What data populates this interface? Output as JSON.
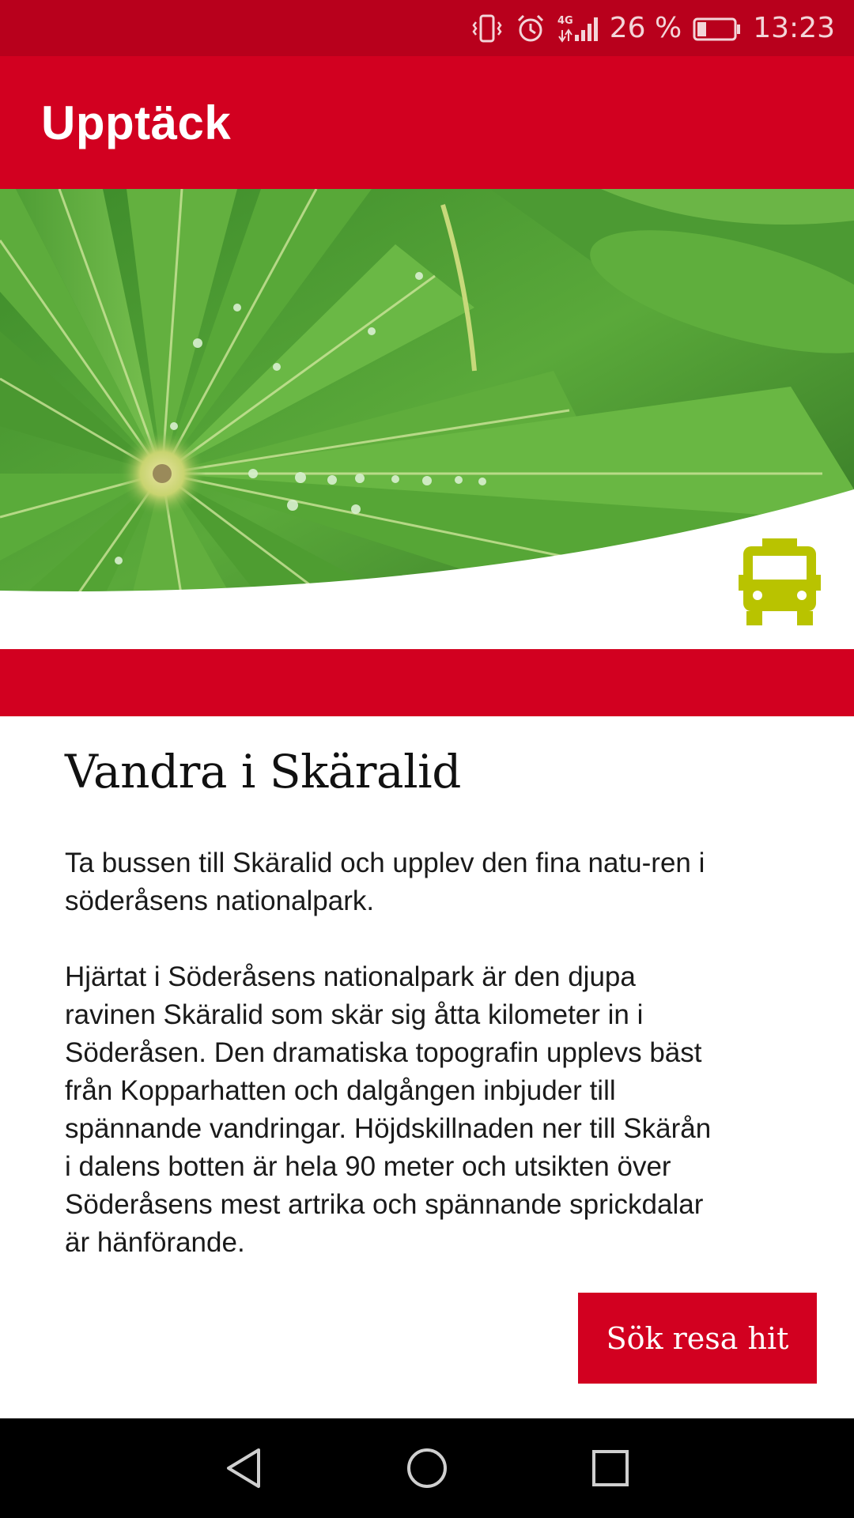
{
  "status_bar": {
    "network": "4G",
    "battery_percent": "26 %",
    "battery_level": 0.26,
    "time": "13:23",
    "icons": [
      "vibrate-icon",
      "alarm-icon",
      "signal-icon",
      "battery-icon"
    ]
  },
  "app_bar": {
    "title": "Upptäck"
  },
  "hero": {
    "image": "lupine-leaves-with-water-drops",
    "badge_icon": "bus-icon",
    "badge_color": "#b9c300"
  },
  "article": {
    "title": "Vandra i Skäralid",
    "paragraphs": [
      "Ta bussen till Skäralid och upplev den fina natu-ren i söderåsens nationalpark.",
      "Hjärtat i Söderåsens nationalpark är den djupa ravinen Skäralid som skär sig åtta kilometer in i Söderåsen. Den dramatiska topografin upplevs bäst från Kopparhatten och dalgången inbjuder till spännande vandringar. Höjdskillnaden ner till Skärån i dalens botten är hela 90 meter och utsikten över Söderåsens mest artrika och spännande sprickdalar är hänförande."
    ],
    "cta_label": "Sök resa hit"
  },
  "nav_bar": {
    "buttons": [
      "back-icon",
      "home-icon",
      "recents-icon"
    ]
  },
  "colors": {
    "brand_red": "#d20020",
    "status_red": "#b8001c",
    "accent_yellow": "#b9c300"
  }
}
